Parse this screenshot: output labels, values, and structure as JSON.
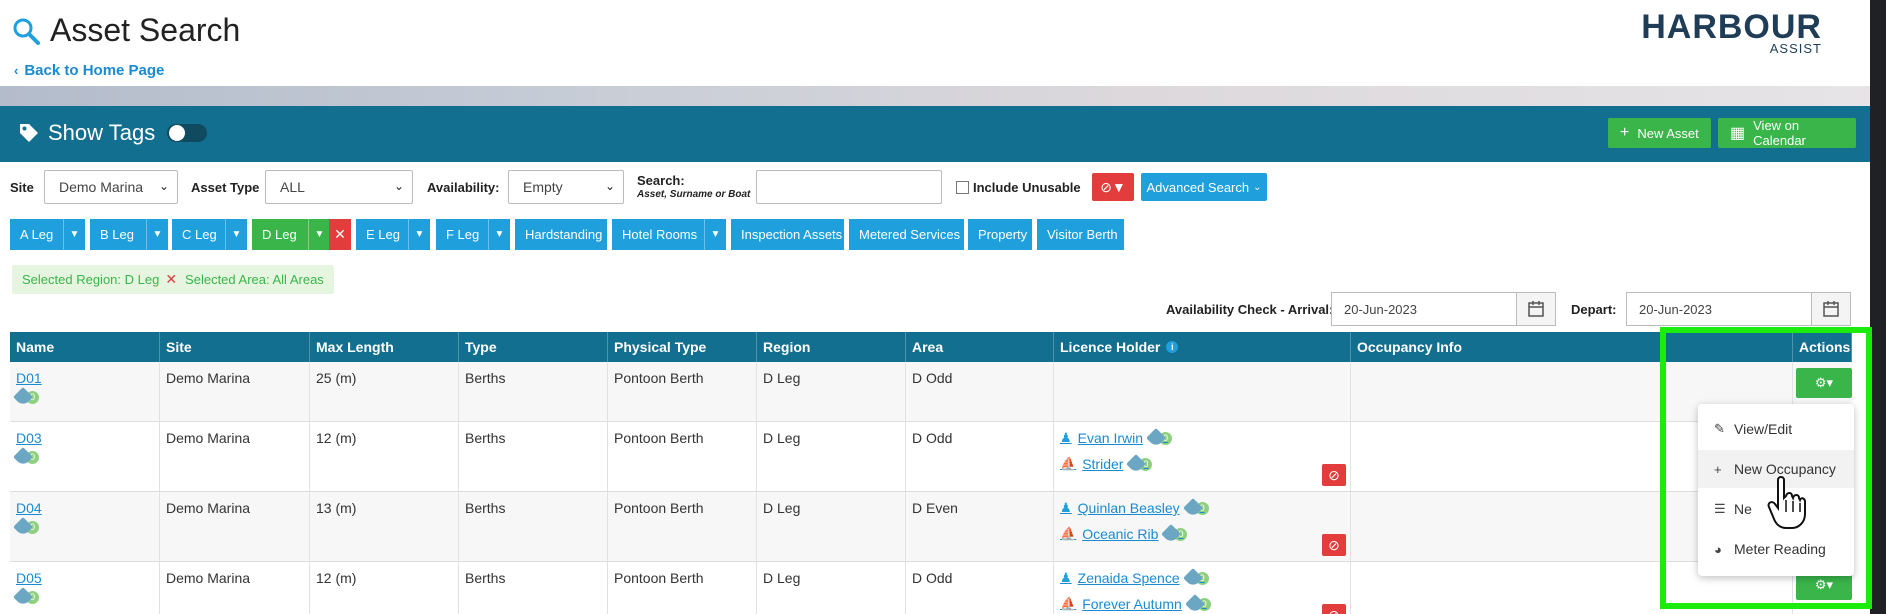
{
  "header": {
    "title": "Asset Search",
    "back_link": "Back to Home Page",
    "logo_main": "HARBOUR",
    "logo_sub": "ASSIST"
  },
  "tagbar": {
    "show_tags_label": "Show Tags",
    "toggle_on": false,
    "new_asset_label": "New Asset",
    "view_calendar_label": "View on Calendar"
  },
  "filters": {
    "site_label": "Site",
    "site_value": "Demo Marina",
    "asset_type_label": "Asset Type",
    "asset_type_value": "ALL",
    "availability_label": "Availability:",
    "availability_value": "Empty",
    "search_label": "Search:",
    "search_sub": "Asset, Surname or Boat",
    "search_value": "",
    "include_unusable_label": "Include Unusable",
    "advanced_search_label": "Advanced Search"
  },
  "regions": [
    {
      "label": "A Leg",
      "dropdown": true,
      "active": false
    },
    {
      "label": "B Leg",
      "dropdown": true,
      "active": false
    },
    {
      "label": "C Leg",
      "dropdown": true,
      "active": false
    },
    {
      "label": "D Leg",
      "dropdown": true,
      "active": true
    },
    {
      "label": "E Leg",
      "dropdown": true,
      "active": false
    },
    {
      "label": "F Leg",
      "dropdown": true,
      "active": false
    },
    {
      "label": "Hardstanding",
      "dropdown": false,
      "active": false
    },
    {
      "label": "Hotel Rooms",
      "dropdown": true,
      "active": false
    },
    {
      "label": "Inspection Assets",
      "dropdown": false,
      "active": false
    },
    {
      "label": "Metered Services",
      "dropdown": false,
      "active": false
    },
    {
      "label": "Property",
      "dropdown": false,
      "active": false
    },
    {
      "label": "Visitor Berth",
      "dropdown": false,
      "active": false
    }
  ],
  "selection": {
    "region": "Selected Region: D Leg",
    "area": "Selected Area: All Areas"
  },
  "availability_check": {
    "arrival_label": "Availability Check - Arrival:",
    "arrival_value": "20-Jun-2023",
    "depart_label": "Depart:",
    "depart_value": "20-Jun-2023"
  },
  "table": {
    "columns": [
      "Name",
      "Site",
      "Max Length",
      "Type",
      "Physical Type",
      "Region",
      "Area",
      "Licence Holder",
      "Occupancy Info",
      "Actions"
    ],
    "rows": [
      {
        "name": "D01",
        "site": "Demo Marina",
        "max_length": "25 (m)",
        "type": "Berths",
        "physical_type": "Pontoon Berth",
        "region": "D Leg",
        "area": "D Odd",
        "tag_count": "0",
        "holder": "",
        "holder_tags": "",
        "boat": "",
        "boat_tags": ""
      },
      {
        "name": "D03",
        "site": "Demo Marina",
        "max_length": "12 (m)",
        "type": "Berths",
        "physical_type": "Pontoon Berth",
        "region": "D Leg",
        "area": "D Odd",
        "tag_count": "0",
        "holder": "Evan Irwin",
        "holder_tags": "0",
        "boat": "Strider",
        "boat_tags": "0"
      },
      {
        "name": "D04",
        "site": "Demo Marina",
        "max_length": "13 (m)",
        "type": "Berths",
        "physical_type": "Pontoon Berth",
        "region": "D Leg",
        "area": "D Even",
        "tag_count": "0",
        "holder": "Quinlan Beasley",
        "holder_tags": "0",
        "boat": "Oceanic Rib",
        "boat_tags": "0"
      },
      {
        "name": "D05",
        "site": "Demo Marina",
        "max_length": "12 (m)",
        "type": "Berths",
        "physical_type": "Pontoon Berth",
        "region": "D Leg",
        "area": "D Odd",
        "tag_count": "0",
        "holder": "Zenaida Spence",
        "holder_tags": "0",
        "boat": "Forever Autumn",
        "boat_tags": "0"
      }
    ]
  },
  "actions_menu": {
    "items": [
      {
        "label": "View/Edit",
        "icon": "edit-icon"
      },
      {
        "label": "New Occupancy",
        "icon": "plus-icon"
      },
      {
        "label": "Ne",
        "icon": "checklist-icon"
      },
      {
        "label": "Meter Reading",
        "icon": "gauge-icon"
      }
    ]
  },
  "colors": {
    "header_blue": "#136f8f",
    "accent_blue": "#1fa0dc",
    "green": "#39b54a",
    "red": "#e23c3c",
    "highlight": "#1cec0c"
  }
}
